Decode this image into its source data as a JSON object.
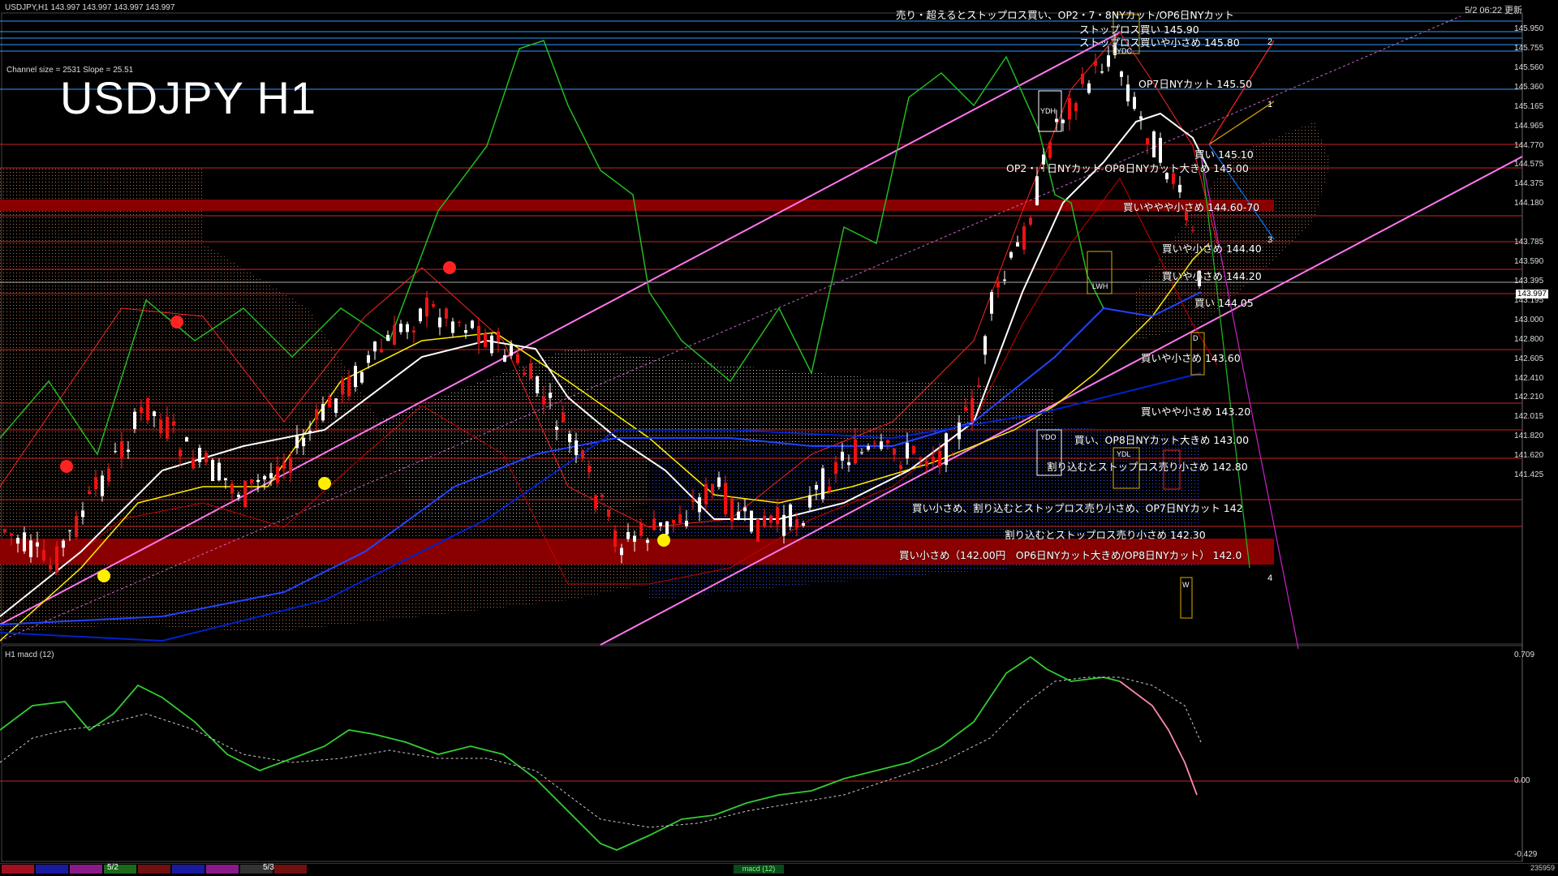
{
  "header": {
    "symbol_info": "USDJPY,H1  143.997 143.997 143.997 143.997",
    "channel_info": "Channel size = 2531 Slope = 25.51",
    "title": "USDJPY H1",
    "updated": "5/2 06:22 更新",
    "macd_title": "H1  macd (12)"
  },
  "colors": {
    "background": "#000000",
    "support_line": "#cc2222",
    "blue_level": "#3399ff",
    "channel": "#ff77ee",
    "macd_main": "#33cc33",
    "macd_down": "#ff88aa",
    "yellow_ma": "#ffee00",
    "white_ma": "#ffffff"
  },
  "price_axis": [
    "145.950",
    "145.755",
    "145.560",
    "145.360",
    "145.165",
    "144.965",
    "144.770",
    "144.575",
    "144.375",
    "144.180",
    "143.997",
    "143.785",
    "143.590",
    "143.395",
    "143.195",
    "143.000",
    "142.800",
    "142.605",
    "142.410",
    "142.210",
    "142.015",
    "141.820",
    "141.620",
    "141.425"
  ],
  "current_price": "143.997",
  "macd_axis": [
    "0.709",
    "0.00",
    "-0.429"
  ],
  "annotations": [
    {
      "id": "a0",
      "text": "売り・超えるとストップロス買い、OP2・7・8NYカット/OP6日NYカット"
    },
    {
      "id": "a1",
      "text": "ストップロス買い 145.90"
    },
    {
      "id": "a2",
      "text": "ストップロス買いや小さめ 145.80"
    },
    {
      "id": "a3",
      "text": "OP7日NYカット 145.50"
    },
    {
      "id": "a4",
      "text": "買い 145.10"
    },
    {
      "id": "a5",
      "text": "OP2・・日NYカット OP8日NYカット大きめ 145.00"
    },
    {
      "id": "a6",
      "text": "買いややや小さめ 144.60-70"
    },
    {
      "id": "a7",
      "text": "買いや小さめ 144.40"
    },
    {
      "id": "a8",
      "text": "買いや小さめ 144.20"
    },
    {
      "id": "a9",
      "text": "買い 144.05"
    },
    {
      "id": "a10",
      "text": "買いや小さめ 143.60"
    },
    {
      "id": "a11",
      "text": "買いやや小さめ 143.20"
    },
    {
      "id": "a12",
      "text": "買い、OP8日NYカット大きめ 143.00"
    },
    {
      "id": "a13",
      "text": "割り込むとストップロス売り小さめ 142.80"
    },
    {
      "id": "a14",
      "text": "買い小さめ、割り込むとストップロス売り小さめ、OP7日NYカット 142"
    },
    {
      "id": "a15",
      "text": "割り込むとストップロス売り小さめ 142.30"
    },
    {
      "id": "a16",
      "text": "買い小さめ（142.00円　OP6日NYカット大きめ/OP8日NYカット） 142.0"
    }
  ],
  "wave_numbers": [
    "1",
    "2",
    "3",
    "4"
  ],
  "box_labels": [
    "YDC",
    "YDH",
    "LWH",
    "YDO",
    "YDL",
    "D",
    "W"
  ],
  "bottom_labels": [
    "5/2",
    "5/3"
  ],
  "bottom_tab": "macd (12)",
  "bottom_right": "235959"
}
